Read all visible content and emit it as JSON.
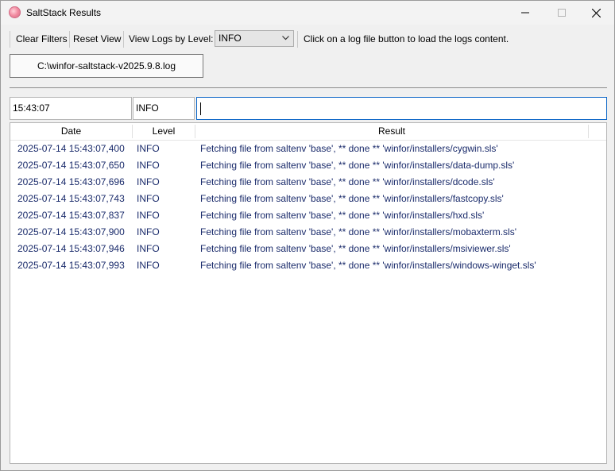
{
  "window": {
    "title": "SaltStack Results"
  },
  "toolbar": {
    "clear_filters": "Clear Filters",
    "reset_view": "Reset View",
    "level_label": "View Logs by Level:",
    "level_selected": "INFO",
    "hint": "Click on a log file button to load the logs content."
  },
  "file_button": "C:\\winfor-saltstack-v2025.9.8.log",
  "filters": {
    "date": "15:43:07",
    "level": "INFO",
    "result": ""
  },
  "table": {
    "headers": [
      "Date",
      "Level",
      "Result"
    ],
    "rows": [
      {
        "date": "2025-07-14 15:43:07,400",
        "level": "INFO",
        "result": "Fetching file from saltenv 'base', ** done ** 'winfor/installers/cygwin.sls'"
      },
      {
        "date": "2025-07-14 15:43:07,650",
        "level": "INFO",
        "result": "Fetching file from saltenv 'base', ** done ** 'winfor/installers/data-dump.sls'"
      },
      {
        "date": "2025-07-14 15:43:07,696",
        "level": "INFO",
        "result": "Fetching file from saltenv 'base', ** done ** 'winfor/installers/dcode.sls'"
      },
      {
        "date": "2025-07-14 15:43:07,743",
        "level": "INFO",
        "result": "Fetching file from saltenv 'base', ** done ** 'winfor/installers/fastcopy.sls'"
      },
      {
        "date": "2025-07-14 15:43:07,837",
        "level": "INFO",
        "result": "Fetching file from saltenv 'base', ** done ** 'winfor/installers/hxd.sls'"
      },
      {
        "date": "2025-07-14 15:43:07,900",
        "level": "INFO",
        "result": "Fetching file from saltenv 'base', ** done ** 'winfor/installers/mobaxterm.sls'"
      },
      {
        "date": "2025-07-14 15:43:07,946",
        "level": "INFO",
        "result": "Fetching file from saltenv 'base', ** done ** 'winfor/installers/msiviewer.sls'"
      },
      {
        "date": "2025-07-14 15:43:07,993",
        "level": "INFO",
        "result": "Fetching file from saltenv 'base', ** done ** 'winfor/installers/windows-winget.sls'"
      }
    ]
  }
}
